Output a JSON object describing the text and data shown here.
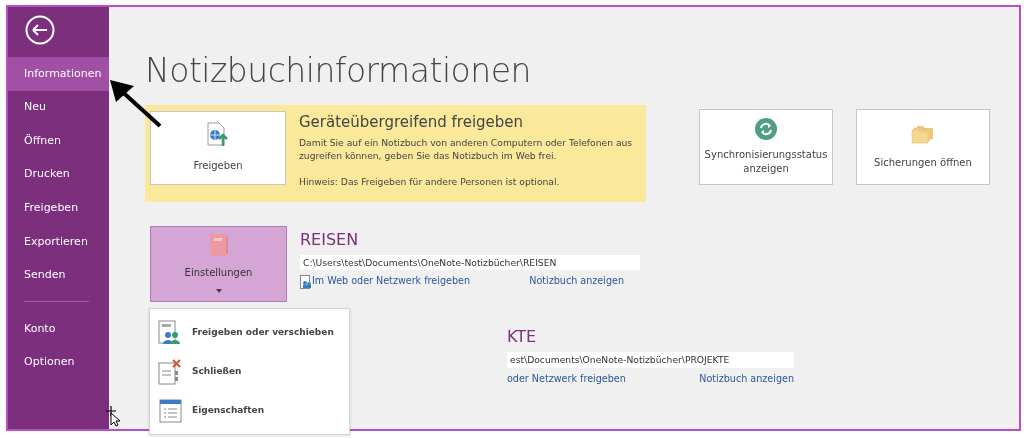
{
  "sidebar": {
    "items": [
      {
        "label": "Informationen",
        "selected": true
      },
      {
        "label": "Neu",
        "selected": false
      },
      {
        "label": "Öffnen",
        "selected": false
      },
      {
        "label": "Drucken",
        "selected": false
      },
      {
        "label": "Freigeben",
        "selected": false
      },
      {
        "label": "Exportieren",
        "selected": false
      },
      {
        "label": "Senden",
        "selected": false
      }
    ],
    "footer_items": [
      {
        "label": "Konto",
        "selected": false
      },
      {
        "label": "Optionen",
        "selected": false
      }
    ]
  },
  "page_title": "Notizbuchinformationen",
  "share_panel": {
    "button": "Freigeben",
    "title": "Geräteübergreifend freigeben",
    "description": "Damit Sie auf ein Notizbuch von anderen Computern oder Telefonen aus zugreifen können, geben Sie das Notizbuch im Web frei.",
    "hint": "Hinweis: Das Freigeben für andere Personen ist optional."
  },
  "action_buttons": [
    {
      "kind": "sync",
      "label": "Synchronisierungsstatus anzeigen"
    },
    {
      "kind": "backup",
      "label": "Sicherungen öffnen"
    }
  ],
  "settings_button": {
    "label": "Einstellungen",
    "expanded": true
  },
  "notebooks": [
    {
      "title": "REISEN",
      "path": "C:\\Users\\test\\Documents\\OneNote-Notizbücher\\REISEN",
      "share_link": "Im Web oder Netzwerk freigeben",
      "share_icon": true,
      "view_link": "Notizbuch anzeigen"
    },
    {
      "title": "KTE",
      "path": "est\\Documents\\OneNote-Notizbücher\\PROJEKTE",
      "share_link": "oder Netzwerk freigeben",
      "share_icon": false,
      "view_link": "Notizbuch anzeigen"
    }
  ],
  "settings_menu": [
    {
      "kind": "share",
      "label": "Freigeben oder verschieben"
    },
    {
      "kind": "close",
      "label": "Schließen"
    },
    {
      "kind": "properties",
      "label": "Eigenschaften"
    }
  ]
}
